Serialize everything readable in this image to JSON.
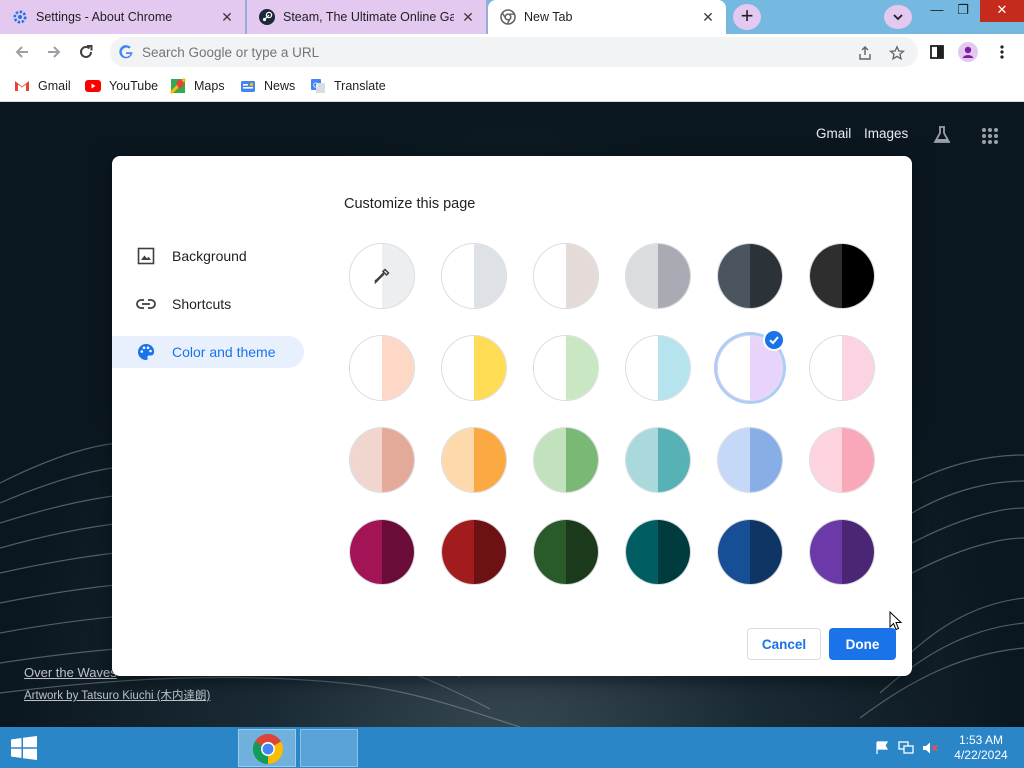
{
  "tabs": [
    {
      "title": "Settings - About Chrome"
    },
    {
      "title": "Steam, The Ultimate Online Game Platform"
    },
    {
      "title": "New Tab"
    }
  ],
  "omnibox": {
    "placeholder": "Search Google or type a URL"
  },
  "bookmarks": [
    {
      "label": "Gmail"
    },
    {
      "label": "YouTube"
    },
    {
      "label": "Maps"
    },
    {
      "label": "News"
    },
    {
      "label": "Translate"
    }
  ],
  "ntp": {
    "gmail_link": "Gmail",
    "images_link": "Images",
    "attribution_title": "Over the Waves",
    "attribution_artist": "Artwork by Tatsuro Kiuchi (木内達朗)"
  },
  "dialog": {
    "title": "Customize this page",
    "menu": [
      {
        "label": "Background",
        "icon": "image-icon"
      },
      {
        "label": "Shortcuts",
        "icon": "link-icon"
      },
      {
        "label": "Color and theme",
        "icon": "palette-icon"
      }
    ],
    "selected_menu": "Color and theme",
    "cancel_label": "Cancel",
    "done_label": "Done",
    "swatches": [
      [
        [
          "#ffffff",
          "#eceef0"
        ],
        [
          "#ffffff",
          "#dee1e6"
        ],
        [
          "#ffffff",
          "#e4dad8"
        ],
        [
          "#dadce0",
          "#a8abb3"
        ],
        [
          "#4a5560",
          "#2b3238"
        ],
        [
          "#2e2e2e",
          "#000000"
        ]
      ],
      [
        [
          "#ffffff",
          "#fdd8c6"
        ],
        [
          "#ffffff",
          "#fedd55"
        ],
        [
          "#ffffff",
          "#c9e7c3"
        ],
        [
          "#ffffff",
          "#b5e4ee"
        ],
        [
          "#ffffff",
          "#e8d3fb"
        ],
        [
          "#ffffff",
          "#fbd3e3"
        ]
      ],
      [
        [
          "#f0d6cf",
          "#e3a999"
        ],
        [
          "#fdd9ab",
          "#fba942"
        ],
        [
          "#c2e2bd",
          "#7ab876"
        ],
        [
          "#aad9db",
          "#57b2b6"
        ],
        [
          "#c6d8f7",
          "#88aee8"
        ],
        [
          "#fdd3de",
          "#f9a8ba"
        ]
      ],
      [
        [
          "#a31456",
          "#6a0c38"
        ],
        [
          "#a11b1f",
          "#6c1213"
        ],
        [
          "#2a5a2a",
          "#1b3a1c"
        ],
        [
          "#005e62",
          "#003b3e"
        ],
        [
          "#164f96",
          "#0f3565"
        ],
        [
          "#6b3aa8",
          "#4a2675"
        ]
      ]
    ],
    "selected_swatch": [
      1,
      4
    ],
    "accent": "#1a73e8"
  },
  "taskbar": {
    "time": "1:53 AM",
    "date": "4/22/2024"
  }
}
